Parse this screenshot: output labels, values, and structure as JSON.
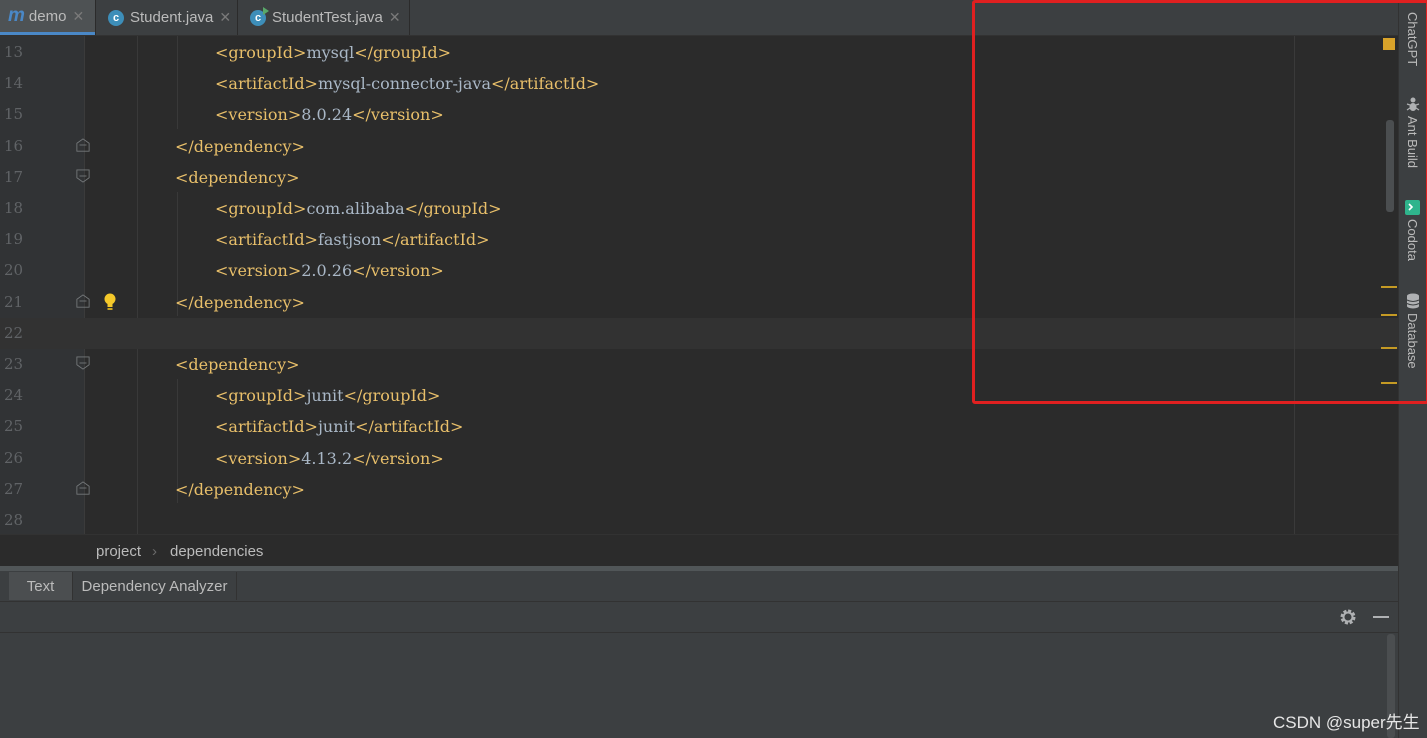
{
  "tabs": [
    {
      "label": "demo",
      "icon": "maven-m-icon",
      "active": true
    },
    {
      "label": "Student.java",
      "icon": "java-class-icon",
      "active": false
    },
    {
      "label": "StudentTest.java",
      "icon": "java-test-class-icon",
      "active": false
    }
  ],
  "editor": {
    "current_line": "22",
    "lines": [
      {
        "num": "13",
        "tag_open": "<groupId>",
        "text": "mysql",
        "tag_close": "</groupId>"
      },
      {
        "num": "14",
        "tag_open": "<artifactId>",
        "text": "mysql-connector-java",
        "tag_close": "</artifactId>"
      },
      {
        "num": "15",
        "tag_open": "<version>",
        "text": "8.0.24",
        "tag_close": "</version>"
      },
      {
        "num": "16",
        "tag_open": "</dependency>",
        "text": "",
        "tag_close": ""
      },
      {
        "num": "17",
        "tag_open": "<dependency>",
        "text": "",
        "tag_close": ""
      },
      {
        "num": "18",
        "tag_open": "<groupId>",
        "text": "com.alibaba",
        "tag_close": "</groupId>"
      },
      {
        "num": "19",
        "tag_open": "<artifactId>",
        "text": "fastjson",
        "tag_close": "</artifactId>"
      },
      {
        "num": "20",
        "tag_open": "<version>",
        "text": "2.0.26",
        "tag_close": "</version>"
      },
      {
        "num": "21",
        "tag_open": "</dependency>",
        "text": "",
        "tag_close": ""
      },
      {
        "num": "22",
        "tag_open": "",
        "text": "",
        "tag_close": ""
      },
      {
        "num": "23",
        "tag_open": "<dependency>",
        "text": "",
        "tag_close": ""
      },
      {
        "num": "24",
        "tag_open": "<groupId>",
        "text": "junit",
        "tag_close": "</groupId>"
      },
      {
        "num": "25",
        "tag_open": "<artifactId>",
        "text": "junit",
        "tag_close": "</artifactId>"
      },
      {
        "num": "26",
        "tag_open": "<version>",
        "text": "4.13.2",
        "tag_close": "</version>"
      },
      {
        "num": "27",
        "tag_open": "</dependency>",
        "text": "",
        "tag_close": ""
      },
      {
        "num": "28",
        "tag_open": "",
        "text": "",
        "tag_close": ""
      }
    ]
  },
  "breadcrumb": {
    "items": [
      "project",
      "dependencies"
    ],
    "separator": "›"
  },
  "bottom_tabs": [
    {
      "label": "Text",
      "active": true
    },
    {
      "label": "Dependency Analyzer",
      "active": false
    }
  ],
  "right_tools": [
    {
      "label": "ChatGPT",
      "icon": ""
    },
    {
      "label": "Ant Build",
      "icon": "ant-icon"
    },
    {
      "label": "Codota",
      "icon": "codota-icon"
    },
    {
      "label": "Database",
      "icon": "database-icon"
    }
  ],
  "colors": {
    "tag": "#e8bf6a",
    "text": "#a9b7c6",
    "highlight_box": "#e02020",
    "warning_mark": "#c59a24"
  },
  "watermark": "CSDN @super先生"
}
